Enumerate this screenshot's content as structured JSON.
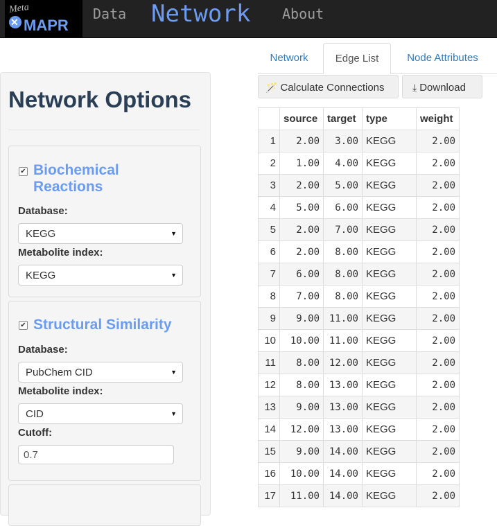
{
  "nav": {
    "logo_text": "MAPR",
    "logo_small_text": "Meta",
    "data_label": "Data",
    "network_label": "Network",
    "about_label": "About"
  },
  "sidebar": {
    "title": "Network Options",
    "biochemical": {
      "checked": true,
      "title": "Biochemical Reactions",
      "database_label": "Database:",
      "database_value": "KEGG",
      "index_label": "Metabolite index:",
      "index_value": "KEGG"
    },
    "structural": {
      "checked": true,
      "title": "Structural Similarity",
      "database_label": "Database:",
      "database_value": "PubChem CID",
      "index_label": "Metabolite index:",
      "index_value": "CID",
      "cutoff_label": "Cutoff:",
      "cutoff_value": "0.7"
    }
  },
  "tabs": [
    "Network",
    "Edge List",
    "Node Attributes"
  ],
  "active_tab": "Edge List",
  "actions": {
    "calculate_label": "Calculate Connections",
    "download_label": "Download"
  },
  "table": {
    "columns": [
      "",
      "source",
      "target",
      "type",
      "weight"
    ],
    "rows": [
      [
        "1",
        "2.00",
        "3.00",
        "KEGG",
        "2.00"
      ],
      [
        "2",
        "1.00",
        "4.00",
        "KEGG",
        "2.00"
      ],
      [
        "3",
        "2.00",
        "5.00",
        "KEGG",
        "2.00"
      ],
      [
        "4",
        "5.00",
        "6.00",
        "KEGG",
        "2.00"
      ],
      [
        "5",
        "2.00",
        "7.00",
        "KEGG",
        "2.00"
      ],
      [
        "6",
        "2.00",
        "8.00",
        "KEGG",
        "2.00"
      ],
      [
        "7",
        "6.00",
        "8.00",
        "KEGG",
        "2.00"
      ],
      [
        "8",
        "7.00",
        "8.00",
        "KEGG",
        "2.00"
      ],
      [
        "9",
        "9.00",
        "11.00",
        "KEGG",
        "2.00"
      ],
      [
        "10",
        "10.00",
        "11.00",
        "KEGG",
        "2.00"
      ],
      [
        "11",
        "8.00",
        "12.00",
        "KEGG",
        "2.00"
      ],
      [
        "12",
        "8.00",
        "13.00",
        "KEGG",
        "2.00"
      ],
      [
        "13",
        "9.00",
        "13.00",
        "KEGG",
        "2.00"
      ],
      [
        "14",
        "12.00",
        "13.00",
        "KEGG",
        "2.00"
      ],
      [
        "15",
        "9.00",
        "14.00",
        "KEGG",
        "2.00"
      ],
      [
        "16",
        "10.00",
        "14.00",
        "KEGG",
        "2.00"
      ],
      [
        "17",
        "11.00",
        "14.00",
        "KEGG",
        "2.00"
      ]
    ]
  },
  "colors": {
    "navbar_bg": "#222222",
    "accent": "#6c9cf1",
    "title": "#2a3f56",
    "link": "#337ab7"
  }
}
